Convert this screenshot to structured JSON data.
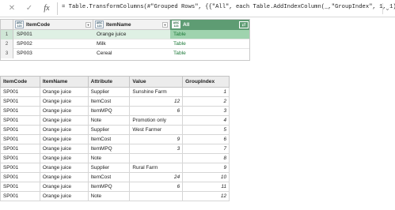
{
  "formula_bar": {
    "cancel_icon": "✕",
    "confirm_icon": "✓",
    "fx_label": "fx",
    "formula": "= Table.TransformColumns(#\"Grouped Rows\", {{\"All\", each Table.AddIndexColumn(_,\"GroupIndex\", 1, 1)}})",
    "expand_icon": "⌄"
  },
  "preview": {
    "columns": [
      {
        "label": "ItemCode",
        "type_icon": "ABC 123"
      },
      {
        "label": "ItemName",
        "type_icon": "ABC 123"
      },
      {
        "label": "All",
        "type_icon": "ABC 123"
      }
    ],
    "rows": [
      {
        "num": "1",
        "code": "SP001",
        "name": "Orange juice",
        "all": "Table"
      },
      {
        "num": "2",
        "code": "SP002",
        "name": "Milk",
        "all": "Table"
      },
      {
        "num": "3",
        "code": "SP003",
        "name": "Cereal",
        "all": "Table"
      }
    ],
    "accent_color": "#5e9c73"
  },
  "result": {
    "headers": [
      "ItemCode",
      "ItemName",
      "Attribute",
      "Value",
      "GroupIndex"
    ],
    "rows": [
      [
        "SP001",
        "Orange juice",
        "Supplier",
        "Sunshine Farm",
        "1"
      ],
      [
        "SP001",
        "Orange juice",
        "ItemCost",
        "12",
        "2"
      ],
      [
        "SP001",
        "Orange juice",
        "ItemMPQ",
        "6",
        "3"
      ],
      [
        "SP001",
        "Orange juice",
        "Note",
        "Promotion only",
        "4"
      ],
      [
        "SP001",
        "Orange juice",
        "Supplier",
        "West Farmer",
        "5"
      ],
      [
        "SP001",
        "Orange juice",
        "ItemCost",
        "9",
        "6"
      ],
      [
        "SP001",
        "Orange juice",
        "ItemMPQ",
        "3",
        "7"
      ],
      [
        "SP001",
        "Orange juice",
        "Note",
        "",
        "8"
      ],
      [
        "SP001",
        "Orange juice",
        "Supplier",
        "Rural Farm",
        "9"
      ],
      [
        "SP001",
        "Orange juice",
        "ItemCost",
        "24",
        "10"
      ],
      [
        "SP001",
        "Orange juice",
        "ItemMPQ",
        "6",
        "11"
      ],
      [
        "SP001",
        "Orange juice",
        "Note",
        "",
        "12"
      ]
    ],
    "numeric_value_rows": [
      1,
      2,
      5,
      6,
      9,
      10
    ]
  }
}
